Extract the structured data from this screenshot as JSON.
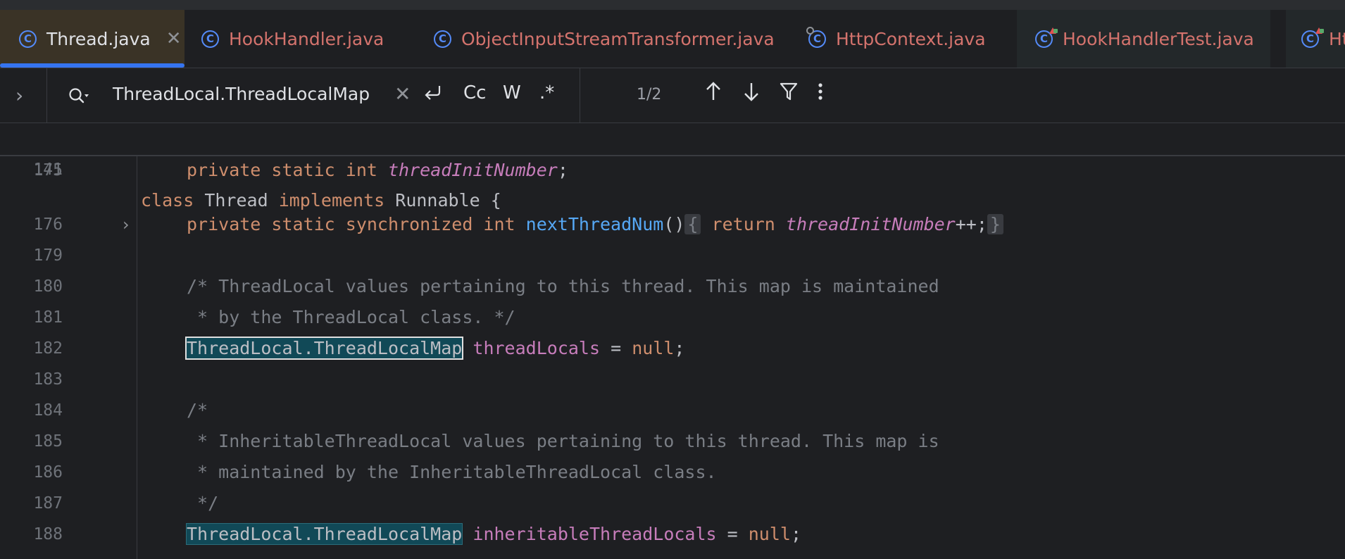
{
  "tabs": [
    {
      "label": "Thread.java",
      "icon": "class-icon",
      "active": true,
      "closable": true
    },
    {
      "label": "HookHandler.java",
      "icon": "class-icon"
    },
    {
      "label": "ObjectInputStreamTransformer.java",
      "icon": "class-icon"
    },
    {
      "label": "HttpContext.java",
      "icon": "interface-class-icon"
    },
    {
      "label": "HookHandlerTest.java",
      "icon": "test-class-icon"
    },
    {
      "label": "Ht",
      "icon": "test-class-icon"
    }
  ],
  "search": {
    "query": "ThreadLocal.ThreadLocalMap",
    "match_case_label": "Cc",
    "words_label": "W",
    "regex_label": ".*",
    "match_count": "1/2"
  },
  "editor": {
    "sticky": {
      "number": "141",
      "code": "class Thread implements Runnable {"
    },
    "lines": [
      {
        "number": "175",
        "tokens": [
          [
            "kw",
            "private static int "
          ],
          [
            "sfld",
            "threadInitNumber"
          ],
          [
            "pl",
            ";"
          ]
        ]
      },
      {
        "number": "176",
        "tokens": [
          [
            "kw",
            "private static synchronized int "
          ],
          [
            "fn",
            "nextThreadNum"
          ],
          [
            "pl",
            "()"
          ],
          [
            "box",
            "{"
          ],
          [
            "kw",
            " return "
          ],
          [
            "sfld",
            "threadInitNumber"
          ],
          [
            "pl",
            "++;"
          ],
          [
            "box",
            "}"
          ]
        ]
      },
      {
        "number": "179",
        "tokens": []
      },
      {
        "number": "180",
        "tokens": [
          [
            "cm",
            "/* ThreadLocal values pertaining to this thread. This map is maintained"
          ]
        ]
      },
      {
        "number": "181",
        "tokens": [
          [
            "cm",
            " * by the ThreadLocal class. */"
          ]
        ]
      },
      {
        "number": "182",
        "tokens": [
          [
            "match-cur",
            "ThreadLocal.ThreadLocalMap"
          ],
          [
            "pl",
            " "
          ],
          [
            "fld",
            "threadLocals"
          ],
          [
            "pl",
            " = "
          ],
          [
            "kw",
            "null"
          ],
          [
            "pl",
            ";"
          ]
        ]
      },
      {
        "number": "183",
        "tokens": []
      },
      {
        "number": "184",
        "tokens": [
          [
            "cm",
            "/*"
          ]
        ]
      },
      {
        "number": "185",
        "tokens": [
          [
            "cm",
            " * InheritableThreadLocal values pertaining to this thread. This map is"
          ]
        ]
      },
      {
        "number": "186",
        "tokens": [
          [
            "cm",
            " * maintained by the InheritableThreadLocal class."
          ]
        ]
      },
      {
        "number": "187",
        "tokens": [
          [
            "cm",
            " */"
          ]
        ]
      },
      {
        "number": "188",
        "tokens": [
          [
            "match",
            "ThreadLocal.ThreadLocalMap"
          ],
          [
            "pl",
            " "
          ],
          [
            "fld",
            "inheritableThreadLocals"
          ],
          [
            "pl",
            " = "
          ],
          [
            "kw",
            "null"
          ],
          [
            "pl",
            ";"
          ]
        ]
      }
    ]
  }
}
